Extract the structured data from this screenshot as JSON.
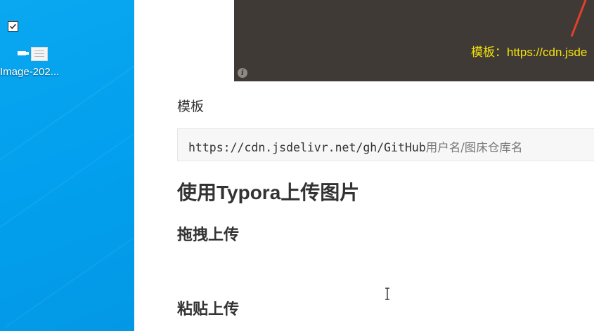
{
  "desktop": {
    "checkbox_checked": true,
    "file_label": "Image-202...",
    "background_color": "#03a0ee"
  },
  "editor": {
    "image": {
      "caption": "模板：https://cdn.jsde",
      "info_icon": "info-icon",
      "background_color": "#3f3a35",
      "caption_color": "#f5e20a"
    },
    "template_label": "模板",
    "code": {
      "prefix": "https://cdn.jsdelivr.net/gh/GitHub",
      "suffix": "用户名/图床仓库名"
    },
    "heading_upload": "使用Typora上传图片",
    "heading_drag": "拖拽上传",
    "heading_paste": "粘贴上传"
  }
}
